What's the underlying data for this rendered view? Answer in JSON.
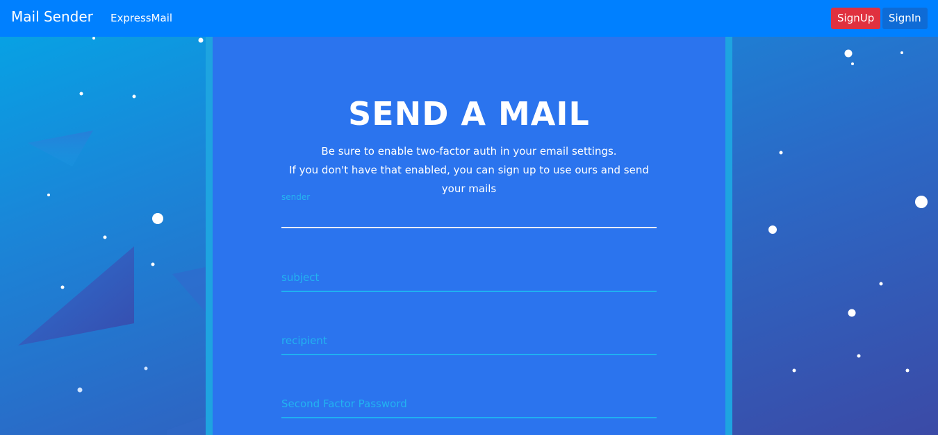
{
  "navbar": {
    "brand": "Mail Sender",
    "link": "ExpressMail",
    "signup_label": "SignUp",
    "signin_label": "SignIn"
  },
  "main": {
    "title": "SEND A MAIL",
    "description_lines": [
      "Be sure to enable two-factor auth in your email settings.",
      "If you don't have that enabled, you can sign up to use ours and send",
      "your mails"
    ],
    "form": {
      "sender": {
        "label": "sender",
        "value": ""
      },
      "subject": {
        "placeholder": "subject",
        "value": ""
      },
      "recipient": {
        "placeholder": "recipient",
        "value": ""
      },
      "second_factor": {
        "placeholder": "Second Factor Password",
        "value": ""
      }
    }
  },
  "colors": {
    "navbar": "#0080ff",
    "signup": "#e0313f",
    "signin": "#0e6bd6",
    "panel": "#2b74ee",
    "field_accent": "#22b3f0"
  }
}
